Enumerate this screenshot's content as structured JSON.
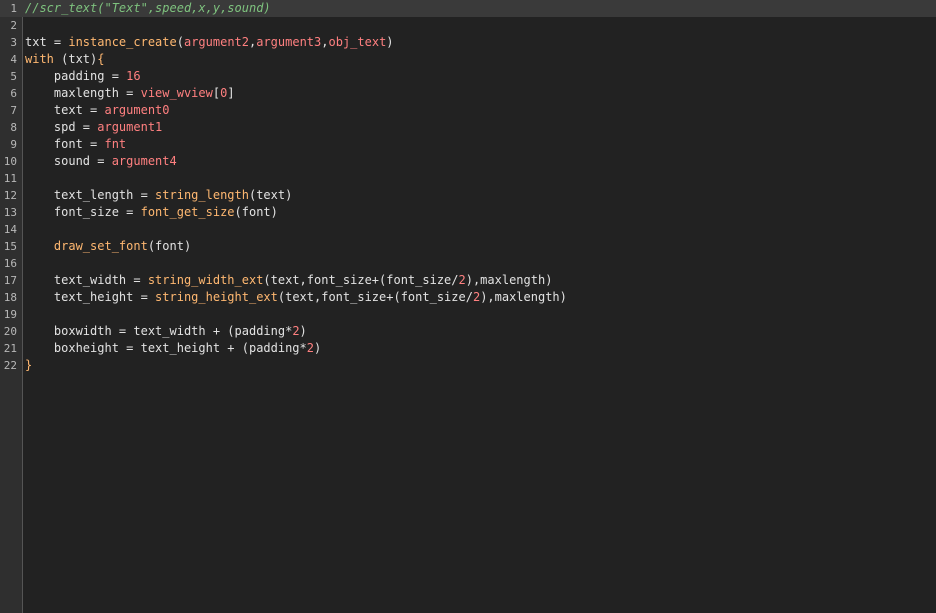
{
  "editor": {
    "lines": [
      {
        "num": "1",
        "tokens": [
          {
            "t": "comment",
            "v": "//scr_text(\"Text\",speed,x,y,sound)"
          }
        ]
      },
      {
        "num": "2",
        "tokens": []
      },
      {
        "num": "3",
        "tokens": [
          {
            "t": "plain",
            "v": "txt = "
          },
          {
            "t": "func",
            "v": "instance_create"
          },
          {
            "t": "punct",
            "v": "("
          },
          {
            "t": "arg",
            "v": "argument2"
          },
          {
            "t": "punct",
            "v": ","
          },
          {
            "t": "arg",
            "v": "argument3"
          },
          {
            "t": "punct",
            "v": ","
          },
          {
            "t": "arg",
            "v": "obj_text"
          },
          {
            "t": "punct",
            "v": ")"
          }
        ]
      },
      {
        "num": "4",
        "tokens": [
          {
            "t": "keyword",
            "v": "with"
          },
          {
            "t": "plain",
            "v": " (txt)"
          },
          {
            "t": "brace",
            "v": "{"
          }
        ]
      },
      {
        "num": "5",
        "tokens": [
          {
            "t": "plain",
            "v": "    padding = "
          },
          {
            "t": "num",
            "v": "16"
          }
        ]
      },
      {
        "num": "6",
        "tokens": [
          {
            "t": "plain",
            "v": "    maxlength = "
          },
          {
            "t": "builtin",
            "v": "view_wview"
          },
          {
            "t": "punct",
            "v": "["
          },
          {
            "t": "num",
            "v": "0"
          },
          {
            "t": "punct",
            "v": "]"
          }
        ]
      },
      {
        "num": "7",
        "tokens": [
          {
            "t": "plain",
            "v": "    text = "
          },
          {
            "t": "arg",
            "v": "argument0"
          }
        ]
      },
      {
        "num": "8",
        "tokens": [
          {
            "t": "plain",
            "v": "    spd = "
          },
          {
            "t": "arg",
            "v": "argument1"
          }
        ]
      },
      {
        "num": "9",
        "tokens": [
          {
            "t": "plain",
            "v": "    font = "
          },
          {
            "t": "arg",
            "v": "fnt"
          }
        ]
      },
      {
        "num": "10",
        "tokens": [
          {
            "t": "plain",
            "v": "    sound = "
          },
          {
            "t": "arg",
            "v": "argument4"
          }
        ]
      },
      {
        "num": "11",
        "tokens": []
      },
      {
        "num": "12",
        "tokens": [
          {
            "t": "plain",
            "v": "    text_length = "
          },
          {
            "t": "func",
            "v": "string_length"
          },
          {
            "t": "plain",
            "v": "(text)"
          }
        ]
      },
      {
        "num": "13",
        "tokens": [
          {
            "t": "plain",
            "v": "    font_size = "
          },
          {
            "t": "func",
            "v": "font_get_size"
          },
          {
            "t": "plain",
            "v": "(font)"
          }
        ]
      },
      {
        "num": "14",
        "tokens": []
      },
      {
        "num": "15",
        "tokens": [
          {
            "t": "plain",
            "v": "    "
          },
          {
            "t": "func",
            "v": "draw_set_font"
          },
          {
            "t": "plain",
            "v": "(font)"
          }
        ]
      },
      {
        "num": "16",
        "tokens": []
      },
      {
        "num": "17",
        "tokens": [
          {
            "t": "plain",
            "v": "    text_width = "
          },
          {
            "t": "func",
            "v": "string_width_ext"
          },
          {
            "t": "plain",
            "v": "(text,font_size+(font_size/"
          },
          {
            "t": "num",
            "v": "2"
          },
          {
            "t": "plain",
            "v": "),maxlength)"
          }
        ]
      },
      {
        "num": "18",
        "tokens": [
          {
            "t": "plain",
            "v": "    text_height = "
          },
          {
            "t": "func",
            "v": "string_height_ext"
          },
          {
            "t": "plain",
            "v": "(text,font_size+(font_size/"
          },
          {
            "t": "num",
            "v": "2"
          },
          {
            "t": "plain",
            "v": "),maxlength)"
          }
        ]
      },
      {
        "num": "19",
        "tokens": []
      },
      {
        "num": "20",
        "tokens": [
          {
            "t": "plain",
            "v": "    boxwidth = text_width + (padding*"
          },
          {
            "t": "num",
            "v": "2"
          },
          {
            "t": "plain",
            "v": ")"
          }
        ]
      },
      {
        "num": "21",
        "tokens": [
          {
            "t": "plain",
            "v": "    boxheight = text_height + (padding*"
          },
          {
            "t": "num",
            "v": "2"
          },
          {
            "t": "plain",
            "v": ")"
          }
        ]
      },
      {
        "num": "22",
        "tokens": [
          {
            "t": "brace",
            "v": "}"
          }
        ]
      }
    ],
    "current_line": 1,
    "colors": {
      "background": "#222222",
      "gutter": "#2f2f2f",
      "current_line": "#3a3a3a",
      "comment": "#7ec27e",
      "function": "#ffb871",
      "argument": "#ff8080",
      "text": "#e2e2e2"
    }
  }
}
